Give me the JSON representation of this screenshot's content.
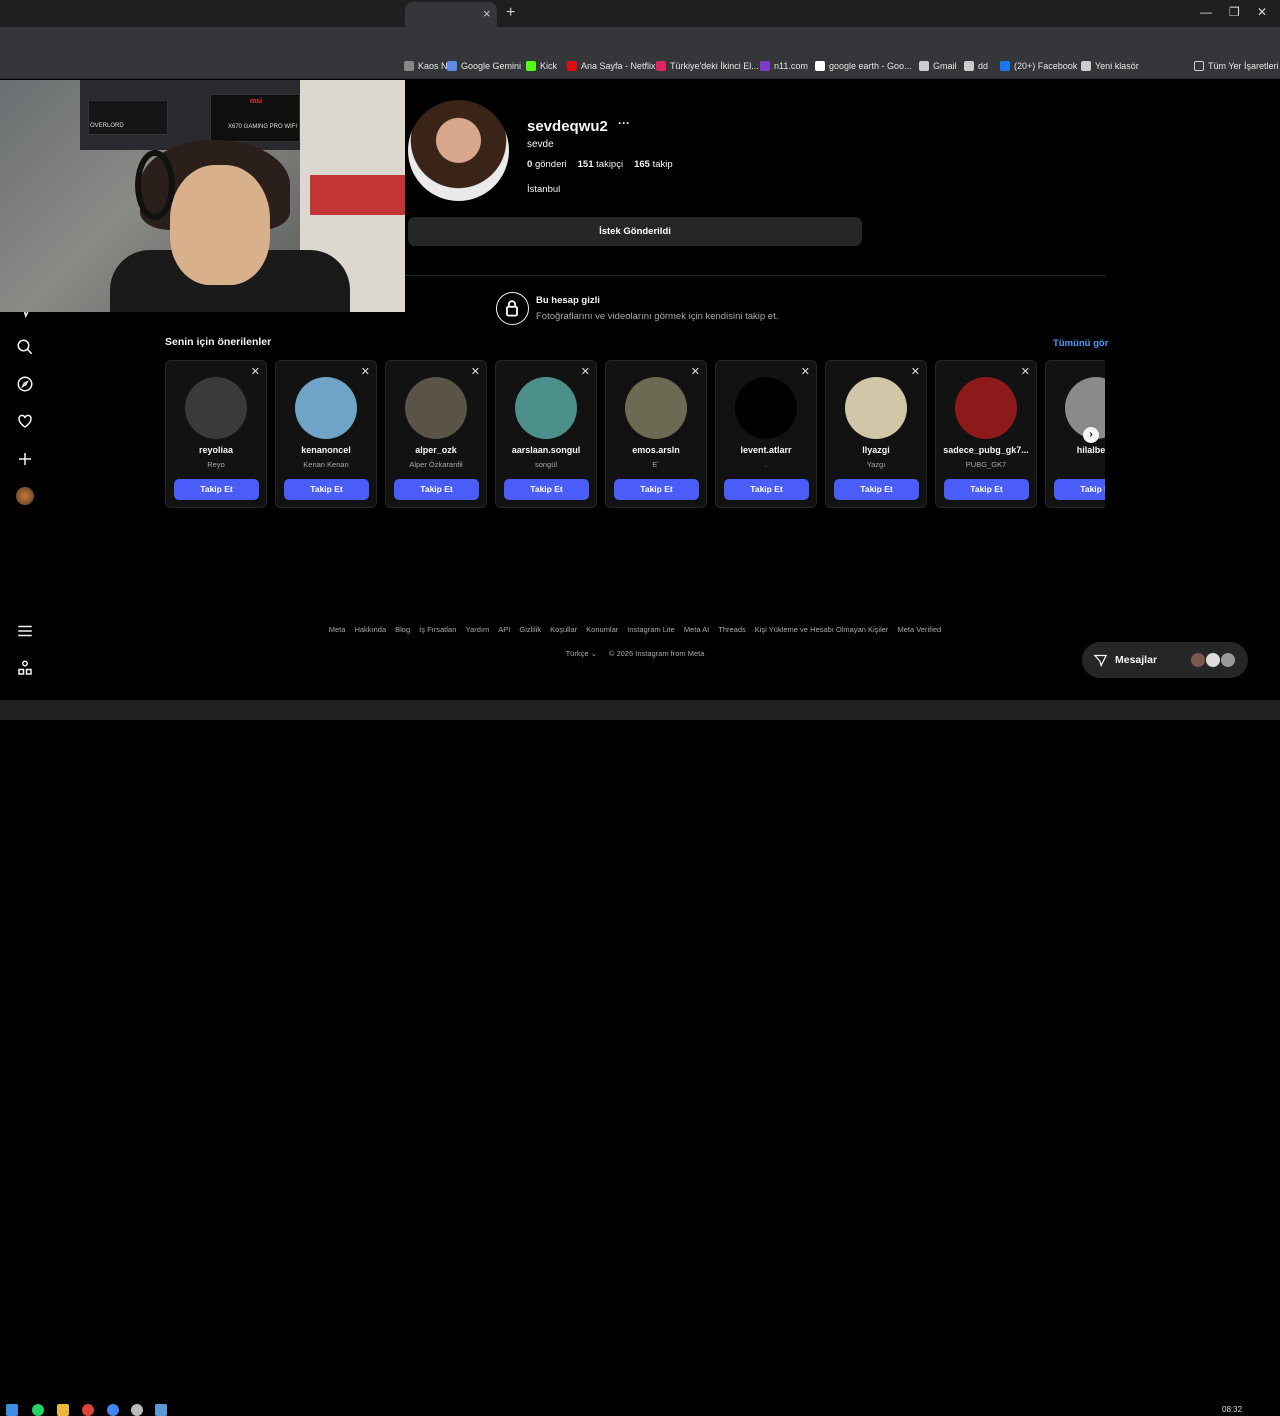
{
  "browser": {
    "tab_close": "×",
    "new_tab": "+",
    "window_controls": [
      "—",
      "❐",
      "✕"
    ],
    "bookmarks": [
      {
        "label": "Kaos N...",
        "icon": "globe-icon",
        "color": "#888888"
      },
      {
        "label": "Google Gemini",
        "icon": "gemini-icon",
        "color": "#5b8def"
      },
      {
        "label": "Kick",
        "icon": "kick-icon",
        "color": "#53fc18"
      },
      {
        "label": "Ana Sayfa - Netflix",
        "icon": "netflix-icon",
        "color": "#e50914"
      },
      {
        "label": "Türkiye'deki İkinci El...",
        "icon": "sahibinden-icon",
        "color": "#e0245e"
      },
      {
        "label": "n11.com",
        "icon": "n11-icon",
        "color": "#7a3cc9"
      },
      {
        "label": "google earth - Goo...",
        "icon": "google-icon",
        "color": "#ffffff"
      },
      {
        "label": "Gmail",
        "icon": "folder-icon",
        "color": "#cccccc"
      },
      {
        "label": "dd",
        "icon": "github-icon",
        "color": "#cccccc"
      },
      {
        "label": "(20+) Facebook",
        "icon": "facebook-icon",
        "color": "#1877f2"
      },
      {
        "label": "Yeni klasör",
        "icon": "folder-icon",
        "color": "#cccccc"
      }
    ],
    "all_bookmarks": "Tüm Yer İşaretleri"
  },
  "profile": {
    "username": "sevdeqwu2",
    "more": "···",
    "full_name": "sevde",
    "posts_count": "0",
    "posts_label": "gönderi",
    "followers_count": "151",
    "followers_label": "takipçi",
    "following_count": "165",
    "following_label": "takip",
    "city": "İstanbul",
    "request_button": "İstek Gönderildi"
  },
  "private": {
    "title": "Bu hesap gizli",
    "subtitle": "Fotoğraflarını ve videolarını görmek için kendisini takip et."
  },
  "suggestions": {
    "title": "Senin için önerilenler",
    "see_all": "Tümünü gör",
    "follow_label": "Takip Et",
    "close": "✕",
    "items": [
      {
        "username": "reyoliaa",
        "name": "Reyo",
        "color": "#3a3a3a"
      },
      {
        "username": "kenanoncel",
        "name": "Kenan Kenan",
        "color": "#6fa3c7"
      },
      {
        "username": "alper_ozk",
        "name": "Alper Özkaranfil",
        "color": "#5a5448"
      },
      {
        "username": "aarslaan.songul",
        "name": "songül",
        "color": "#4d8f8a"
      },
      {
        "username": "emos.arsln",
        "name": "E`",
        "color": "#6b6a52"
      },
      {
        "username": "levent.atlarr",
        "name": ".",
        "color": "#000000"
      },
      {
        "username": "llyazgi",
        "name": "Yazgı",
        "color": "#cfc7a8"
      },
      {
        "username": "sadece_pubg_gk7...",
        "name": "PUBG_GK7",
        "color": "#8c1a1a"
      },
      {
        "username": "hilalbeve",
        "name": "",
        "color": "#8a8a8a"
      }
    ]
  },
  "footer": {
    "links": [
      "Meta",
      "Hakkında",
      "Blog",
      "İş Fırsatları",
      "Yardım",
      "API",
      "Gizlilik",
      "Koşullar",
      "Konumlar",
      "Instagram Lite",
      "Meta AI",
      "Threads",
      "Kişi Yükleme ve Hesabı Olmayan Kişiler",
      "Meta Verified"
    ],
    "language": "Türkçe",
    "copyright": "© 2026 Instagram from Meta"
  },
  "messages": {
    "label": "Mesajlar"
  },
  "taskbar": {
    "clock": "08:32"
  },
  "webcam": {
    "label_left": "OVERLORD",
    "label_msi": "msi",
    "label_box": "X670 GAMING PRO WIFI"
  }
}
